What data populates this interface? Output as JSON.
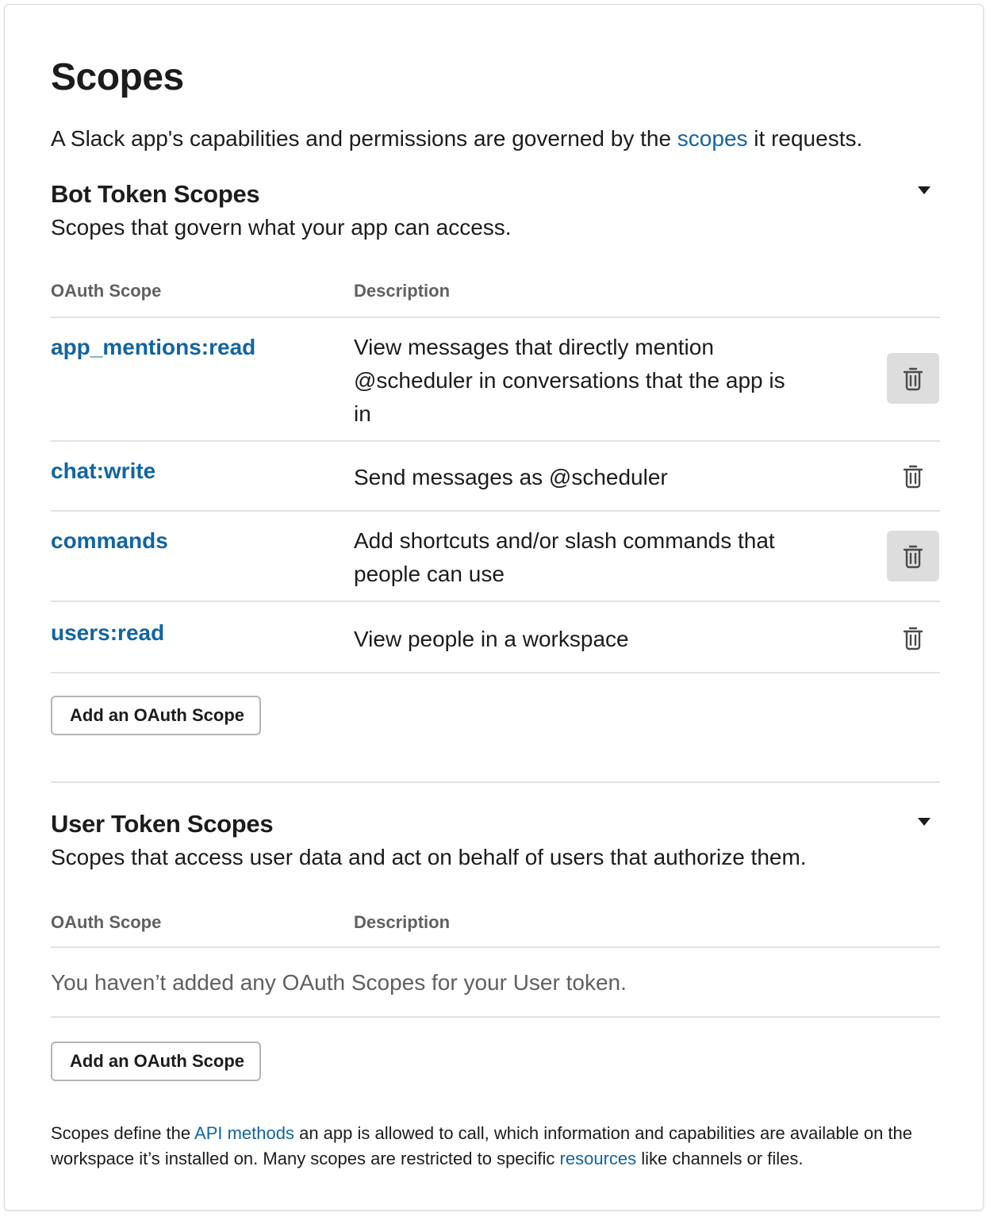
{
  "page": {
    "title": "Scopes",
    "intro_before": "A Slack app's capabilities and permissions are governed by the ",
    "intro_link": "scopes",
    "intro_after": " it requests."
  },
  "bot": {
    "title": "Bot Token Scopes",
    "subtitle": "Scopes that govern what your app can access.",
    "col_scope": "OAuth Scope",
    "col_desc": "Description",
    "rows": [
      {
        "scope": "app_mentions:read",
        "desc": "View messages that directly mention @scheduler in conversations that the app is in"
      },
      {
        "scope": "chat:write",
        "desc": "Send messages as @scheduler"
      },
      {
        "scope": "commands",
        "desc": "Add shortcuts and/or slash commands that people can use"
      },
      {
        "scope": "users:read",
        "desc": "View people in a workspace"
      }
    ],
    "add_button": "Add an OAuth Scope"
  },
  "user": {
    "title": "User Token Scopes",
    "subtitle": "Scopes that access user data and act on behalf of users that authorize them.",
    "col_scope": "OAuth Scope",
    "col_desc": "Description",
    "empty": "You haven’t added any OAuth Scopes for your User token.",
    "add_button": "Add an OAuth Scope"
  },
  "footer": {
    "t1": "Scopes define the ",
    "link1": "API methods",
    "t2": " an app is allowed to call, which information and capabilities are available on the workspace it’s installed on. Many scopes are restricted to specific ",
    "link2": "resources",
    "t3": " like channels or files."
  },
  "colors": {
    "link": "#1264a3",
    "text": "#1d1c1d",
    "muted": "#616061",
    "hover_bg": "#dddddd"
  },
  "icons": {
    "collapse": "caret-down-icon",
    "delete": "trash-icon"
  }
}
